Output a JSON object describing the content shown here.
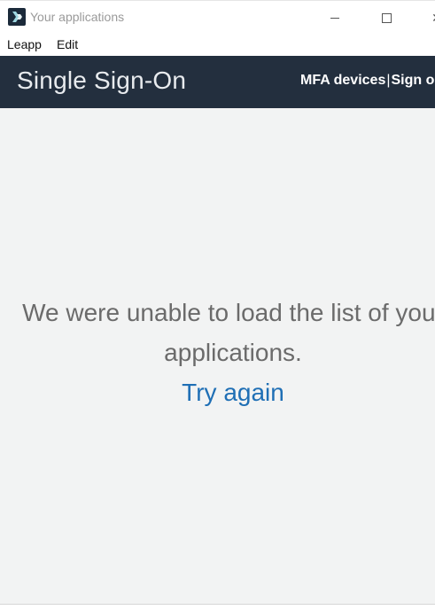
{
  "window": {
    "title": "Your applications"
  },
  "menu": {
    "items": [
      "Leapp",
      "Edit"
    ]
  },
  "header": {
    "brand": "Single Sign-On",
    "nav": {
      "mfa": "MFA devices",
      "separator": "|",
      "signout": "Sign out"
    }
  },
  "content": {
    "error_line1": "We were unable to load the list of your",
    "error_line2": "applications.",
    "retry_link": "Try again"
  },
  "colors": {
    "header_bg": "#232f3e",
    "content_bg": "#f2f3f3",
    "link": "#1f6fb5",
    "message": "#6b6b6b"
  }
}
